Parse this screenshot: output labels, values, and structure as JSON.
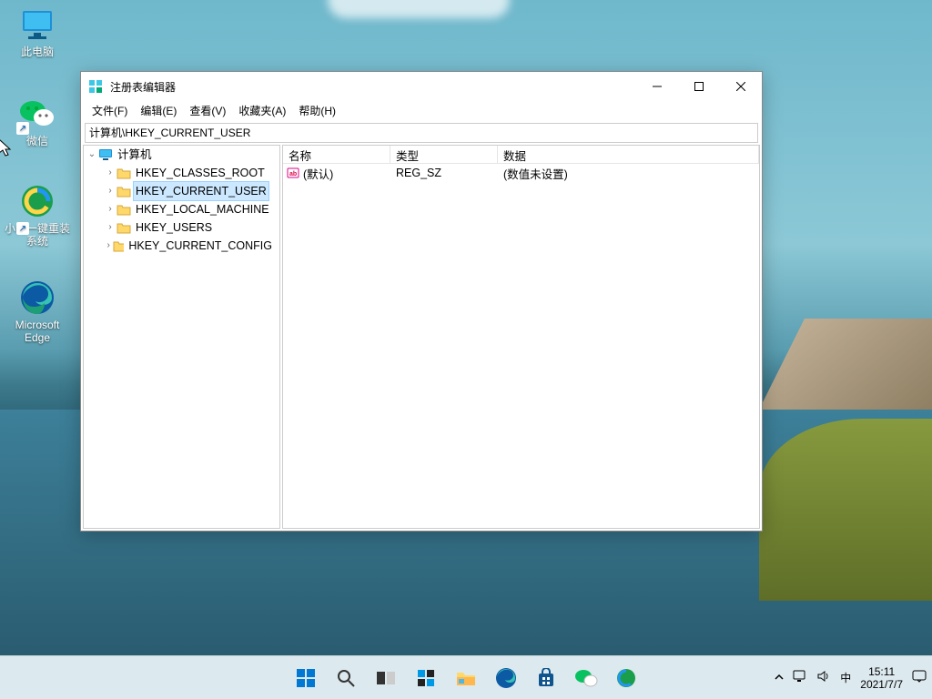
{
  "desktop_icons": [
    {
      "id": "this-pc",
      "label": "此电脑"
    },
    {
      "id": "wechat",
      "label": "微信"
    },
    {
      "id": "xiaobai",
      "label": "小白一键重装\n系统"
    },
    {
      "id": "edge",
      "label": "Microsoft\nEdge"
    }
  ],
  "window": {
    "title": "注册表编辑器",
    "menubar": [
      "文件(F)",
      "编辑(E)",
      "查看(V)",
      "收藏夹(A)",
      "帮助(H)"
    ],
    "address": "计算机\\HKEY_CURRENT_USER",
    "tree": {
      "root": "计算机",
      "hives": [
        "HKEY_CLASSES_ROOT",
        "HKEY_CURRENT_USER",
        "HKEY_LOCAL_MACHINE",
        "HKEY_USERS",
        "HKEY_CURRENT_CONFIG"
      ],
      "selected_index": 1
    },
    "list": {
      "headers": {
        "name": "名称",
        "type": "类型",
        "data": "数据"
      },
      "rows": [
        {
          "name": "(默认)",
          "type": "REG_SZ",
          "data": "(数值未设置)"
        }
      ]
    }
  },
  "taskbar": {
    "items": [
      "start",
      "search",
      "taskview",
      "widgets",
      "explorer",
      "edge",
      "store",
      "wechat",
      "xiaobai"
    ]
  },
  "tray": {
    "ime": "中",
    "time": "15:11",
    "date": "2021/7/7"
  }
}
